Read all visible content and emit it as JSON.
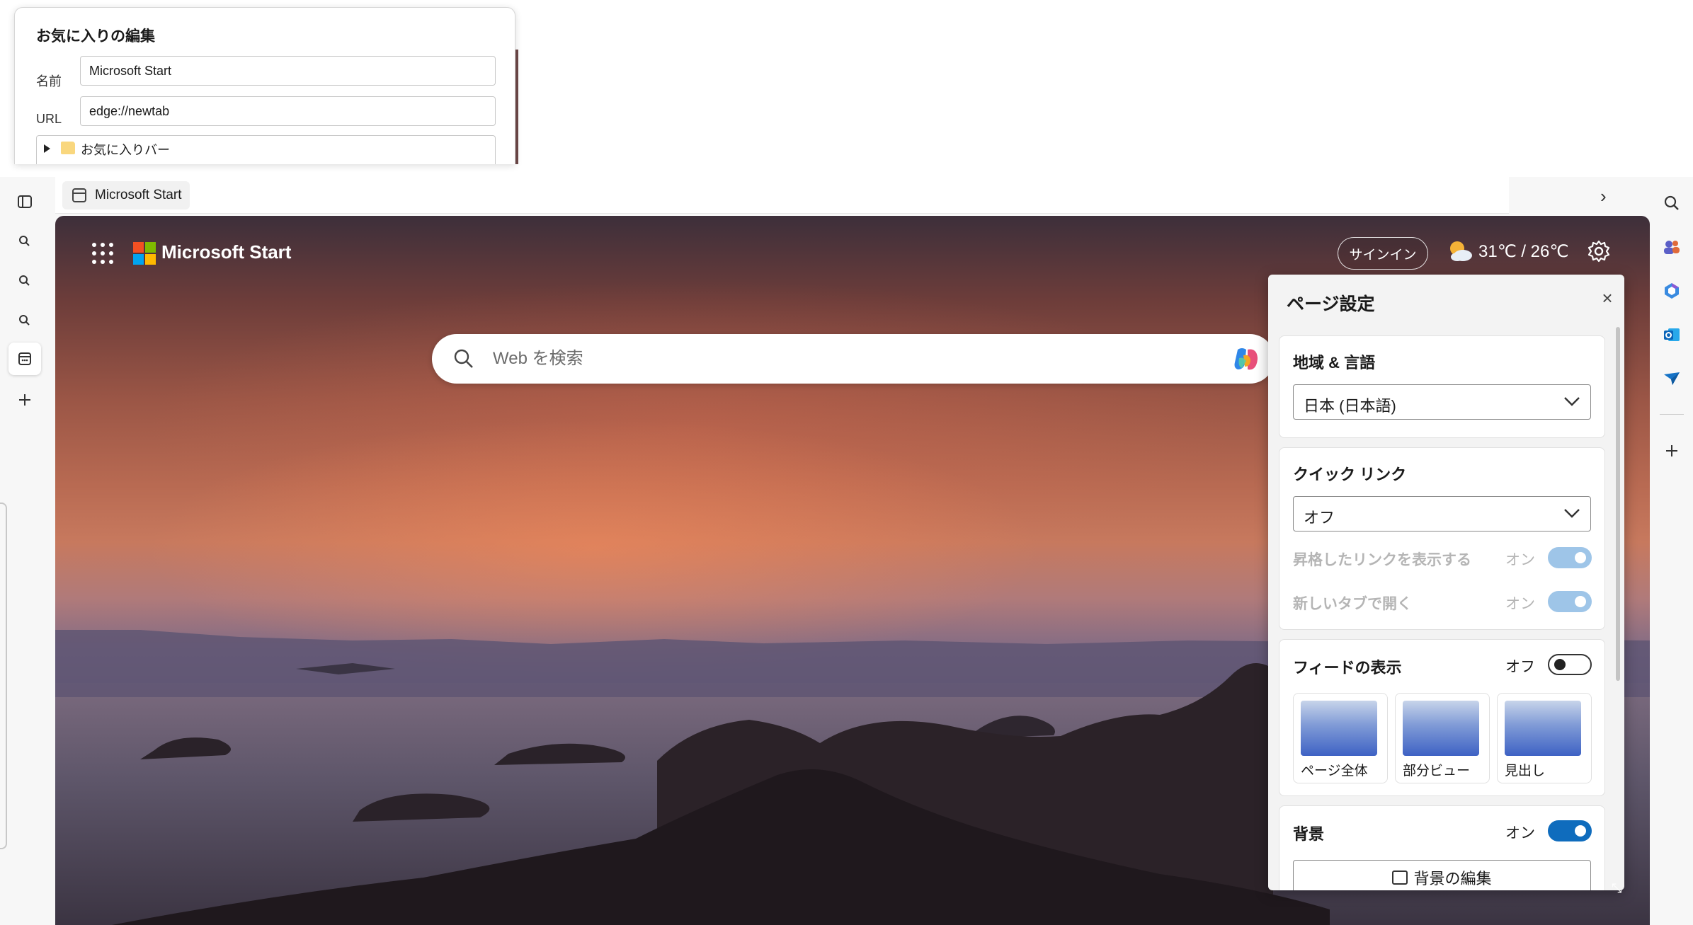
{
  "favorites_dialog": {
    "title": "お気に入りの編集",
    "name_label": "名前",
    "name_value": "Microsoft Start",
    "url_label": "URL",
    "url_value": "edge://newtab",
    "folder_label": "お気に入りバー"
  },
  "tab": {
    "title": "Microsoft Start"
  },
  "ntp": {
    "brand": "Microsoft Start",
    "signin": "サインイン",
    "weather": "31℃ / 26℃",
    "search_placeholder": "Web を検索"
  },
  "page_settings": {
    "title": "ページ設定",
    "region": {
      "title": "地域 & 言語",
      "value": "日本 (日本語)"
    },
    "quick_links": {
      "title": "クイック リンク",
      "value": "オフ",
      "promoted_label": "昇格したリンクを表示する",
      "promoted_state": "オン",
      "new_tab_label": "新しいタブで開く",
      "new_tab_state": "オン"
    },
    "feed": {
      "title": "フィードの表示",
      "state": "オフ",
      "options": [
        "ページ全体",
        "部分ビュー",
        "見出し"
      ]
    },
    "background": {
      "title": "背景",
      "state": "オン",
      "edit_button": "背景の編集"
    }
  },
  "colors": {
    "accent": "#0f6cbd",
    "accent_disabled": "#9ec5e8"
  },
  "icons": [
    "sidebar-toggle-icon",
    "search-icon",
    "calendar-icon",
    "plus-icon",
    "chevron-right-icon",
    "apps-grid-icon",
    "microsoft-logo-icon",
    "weather-icon",
    "gear-icon",
    "copilot-icon",
    "close-icon",
    "chevron-down-icon",
    "image-icon",
    "folder-icon"
  ]
}
